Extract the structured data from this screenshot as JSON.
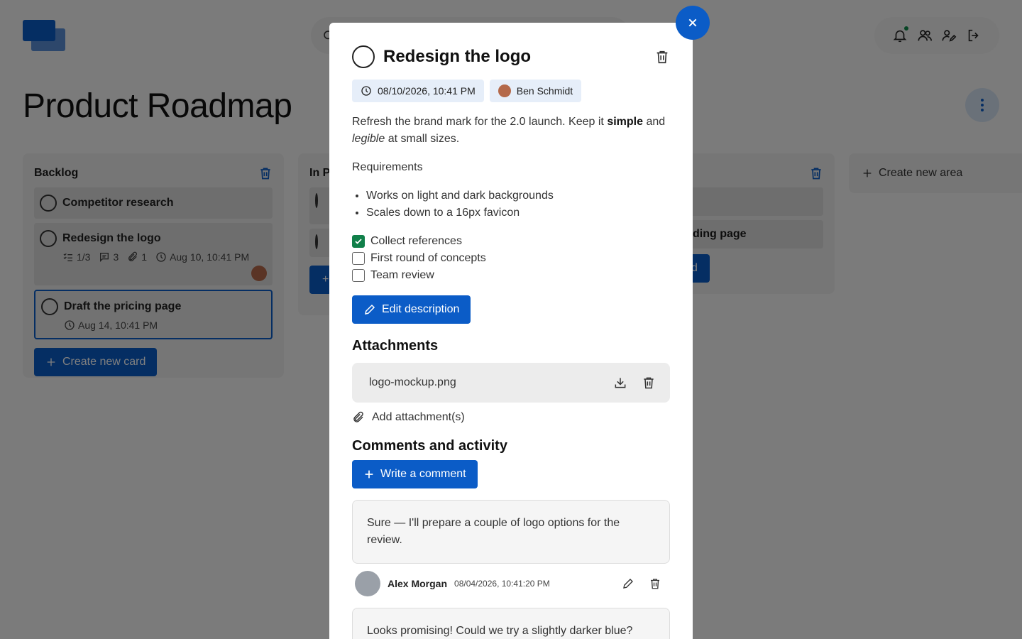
{
  "header": {
    "title": "Product Roadmap"
  },
  "columns": {
    "backlog": {
      "title": "Backlog",
      "cards": [
        {
          "title": "Competitor research"
        },
        {
          "title": "Redesign the logo",
          "checklist": "1/3",
          "comments": "3",
          "attachments": "1",
          "due": "Aug 10, 10:41 PM"
        },
        {
          "title": "Draft the pricing page",
          "due": "Aug 14, 10:41 PM"
        }
      ],
      "create_card_label": "Create new card"
    },
    "in_progress": {
      "title": "In P"
    },
    "done": {
      "card_partial": "ding page",
      "button_partial": "d"
    },
    "create_area_label": "Create new area"
  },
  "modal": {
    "title": "Redesign the logo",
    "due_date": "08/10/2026, 10:41 PM",
    "assignee": "Ben Schmidt",
    "description": {
      "part1": "Refresh the brand mark for the 2.0 launch. Keep it ",
      "bold": "simple",
      "part2": " and ",
      "italic": "legible",
      "part3": " at small sizes."
    },
    "requirements_label": "Requirements",
    "bullets": [
      "Works on light and dark backgrounds",
      "Scales down to a 16px favicon"
    ],
    "checklist": [
      {
        "label": "Collect references",
        "checked": true
      },
      {
        "label": "First round of concepts",
        "checked": false
      },
      {
        "label": "Team review",
        "checked": false
      }
    ],
    "edit_description_label": "Edit description",
    "attachments_title": "Attachments",
    "attachment_file": "logo-mockup.png",
    "add_attachment_label": "Add attachment(s)",
    "comments_title": "Comments and activity",
    "write_comment_label": "Write a comment",
    "comments": [
      {
        "text": "Sure — I'll prepare a couple of logo options for the review.",
        "author": "Alex Morgan",
        "timestamp": "08/04/2026, 10:41:20 PM"
      },
      {
        "text": "Looks promising! Could we try a slightly darker blue?"
      }
    ]
  },
  "colors": {
    "primary": "#0b5cc7",
    "success": "#11804a"
  }
}
